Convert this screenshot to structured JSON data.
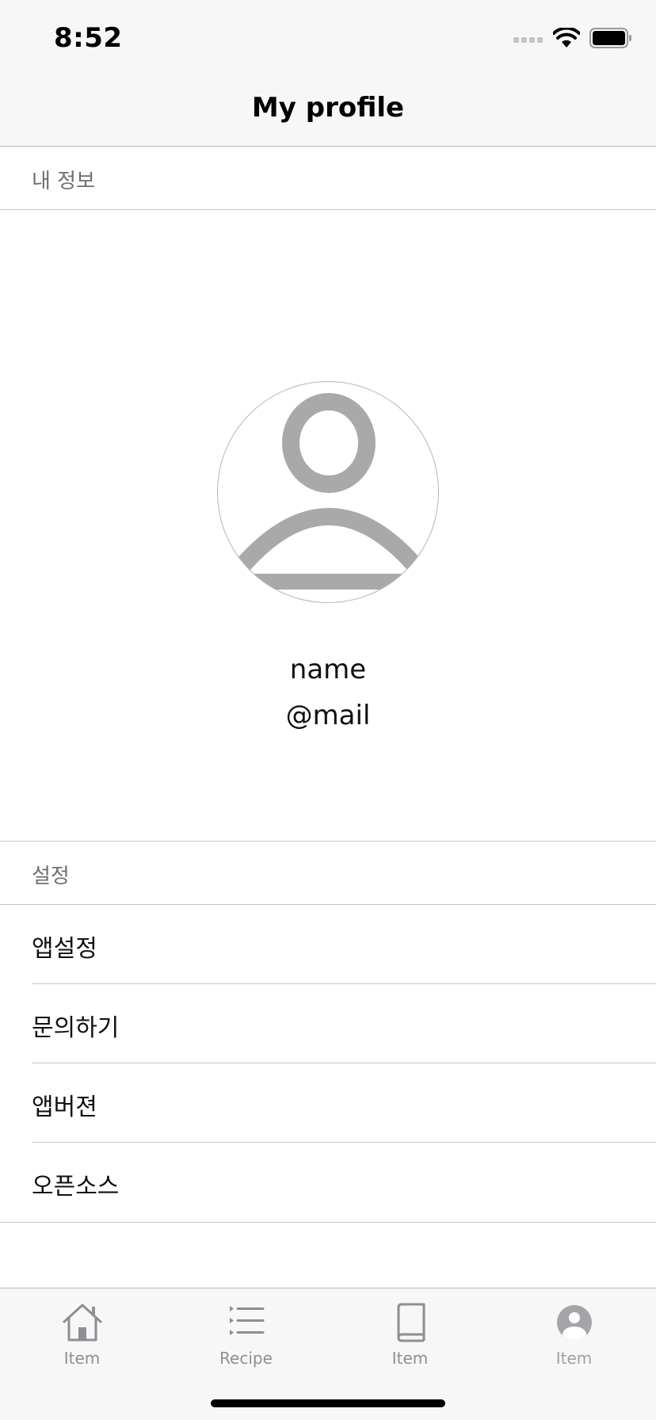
{
  "status_bar": {
    "time": "8:52"
  },
  "nav": {
    "title": "My profile"
  },
  "profile_section": {
    "header": "내 정보",
    "name": "name",
    "mail": "@mail"
  },
  "settings_section": {
    "header": "설정",
    "items": [
      {
        "label": "앱설정"
      },
      {
        "label": "문의하기"
      },
      {
        "label": "앱버젼"
      },
      {
        "label": "오픈소스"
      }
    ]
  },
  "tab_bar": {
    "tabs": [
      {
        "label": "Item",
        "icon": "house-icon"
      },
      {
        "label": "Recipe",
        "icon": "list-icon"
      },
      {
        "label": "Item",
        "icon": "book-icon"
      },
      {
        "label": "Item",
        "icon": "person-circle-icon"
      }
    ],
    "selected_index": 3
  },
  "colors": {
    "bar_background": "#f7f7f7",
    "separator": "#c8c8cc",
    "avatar_gray": "#a9a9a9",
    "tab_gray": "#8e8e93"
  }
}
